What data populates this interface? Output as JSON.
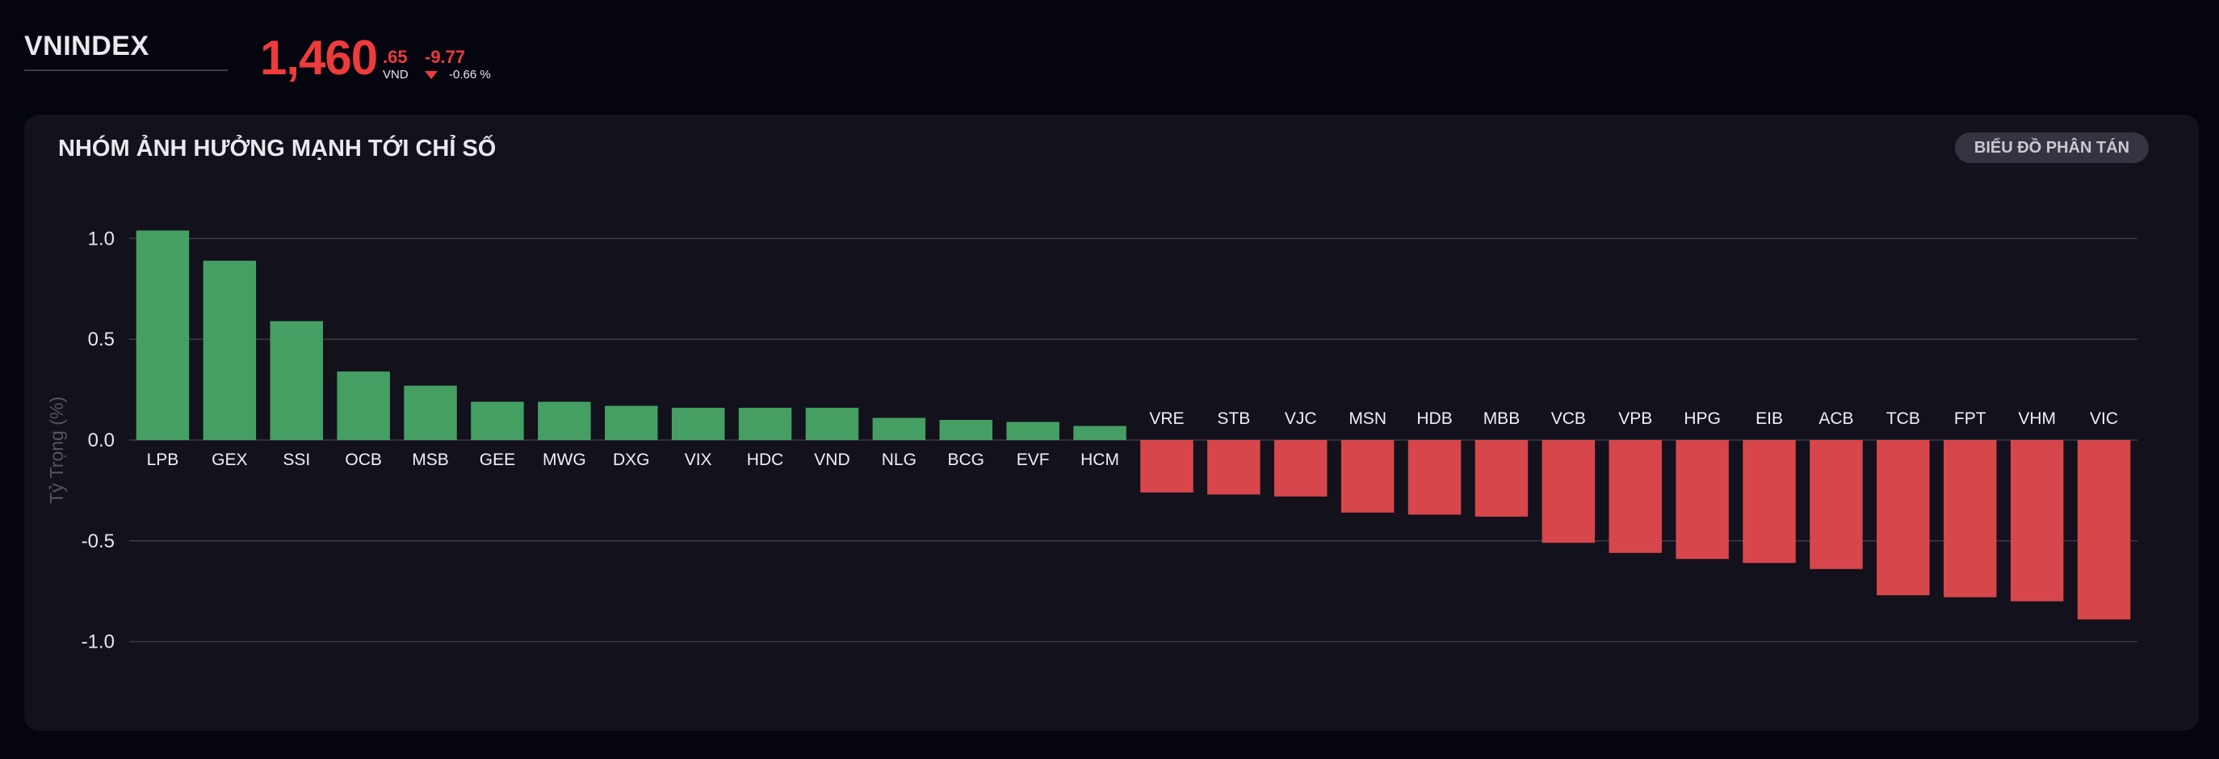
{
  "header": {
    "ticker": "VNINDEX",
    "price_main": "1,460",
    "price_decimal": ".65",
    "currency": "VND",
    "change": "-9.77",
    "change_pct": "-0.66 %"
  },
  "panel": {
    "title": "NHÓM ẢNH HƯỞNG MẠNH TỚI CHỈ SỐ",
    "button_label": "BIỂU ĐỒ PHÂN TÁN"
  },
  "colors": {
    "background": "#05050f",
    "panel": "#12111c",
    "positive": "#459f63",
    "negative": "#d7464a",
    "price_down": "#ee3b3b",
    "grid": "#3a3a46"
  },
  "chart_data": {
    "type": "bar",
    "ylabel": "Tỷ Trọng (%)",
    "ylim": [
      -1.25,
      1.1
    ],
    "yticks": [
      {
        "value": 1.0,
        "label": "1.0"
      },
      {
        "value": 0.5,
        "label": "0.5"
      },
      {
        "value": 0.0,
        "label": "0.0"
      },
      {
        "value": -0.5,
        "label": "-0.5"
      },
      {
        "value": -1.0,
        "label": "-1.0"
      }
    ],
    "grid": true,
    "categories": [
      "LPB",
      "GEX",
      "SSI",
      "OCB",
      "MSB",
      "GEE",
      "MWG",
      "DXG",
      "VIX",
      "HDC",
      "VND",
      "NLG",
      "BCG",
      "EVF",
      "HCM",
      "VRE",
      "STB",
      "VJC",
      "MSN",
      "HDB",
      "MBB",
      "VCB",
      "VPB",
      "HPG",
      "EIB",
      "ACB",
      "TCB",
      "FPT",
      "VHM",
      "VIC"
    ],
    "values": [
      1.04,
      0.89,
      0.59,
      0.34,
      0.27,
      0.19,
      0.19,
      0.17,
      0.16,
      0.16,
      0.16,
      0.11,
      0.1,
      0.09,
      0.07,
      -0.26,
      -0.27,
      -0.28,
      -0.36,
      -0.37,
      -0.38,
      -0.51,
      -0.56,
      -0.59,
      -0.61,
      -0.64,
      -0.77,
      -0.78,
      -0.8,
      -0.89
    ]
  }
}
